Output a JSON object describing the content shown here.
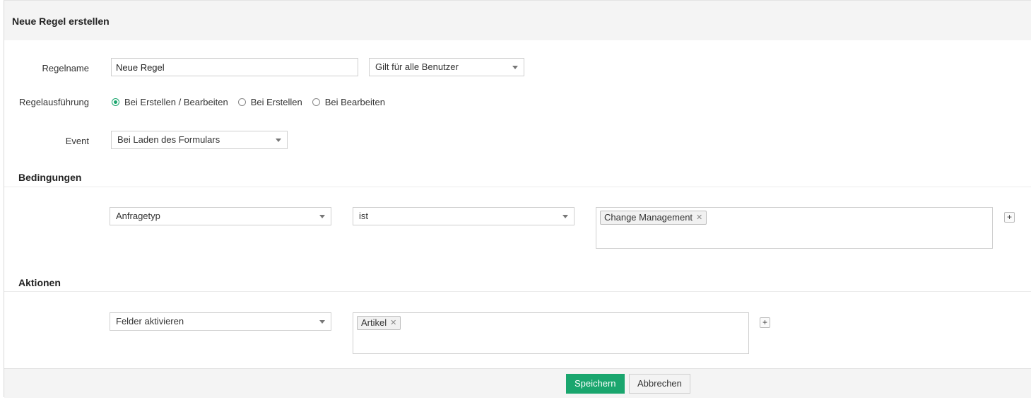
{
  "header": {
    "title": "Neue Regel erstellen"
  },
  "form": {
    "rule_name_label": "Regelname",
    "rule_name_value": "Neue Regel",
    "scope_select": "Gilt für alle Benutzer",
    "execution_label": "Regelausführung",
    "execution_options": [
      {
        "label": "Bei Erstellen / Bearbeiten",
        "checked": true
      },
      {
        "label": "Bei Erstellen",
        "checked": false
      },
      {
        "label": "Bei Bearbeiten",
        "checked": false
      }
    ],
    "event_label": "Event",
    "event_select": "Bei Laden des Formulars"
  },
  "conditions": {
    "title": "Bedingungen",
    "field_select": "Anfragetyp",
    "operator_select": "ist",
    "values": [
      "Change Management"
    ],
    "add_button": "+"
  },
  "actions": {
    "title": "Aktionen",
    "action_select": "Felder aktivieren",
    "values": [
      "Artikel"
    ],
    "add_button": "+"
  },
  "footer": {
    "save_label": "Speichern",
    "cancel_label": "Abbrechen"
  },
  "colors": {
    "accent": "#1aa66e"
  }
}
